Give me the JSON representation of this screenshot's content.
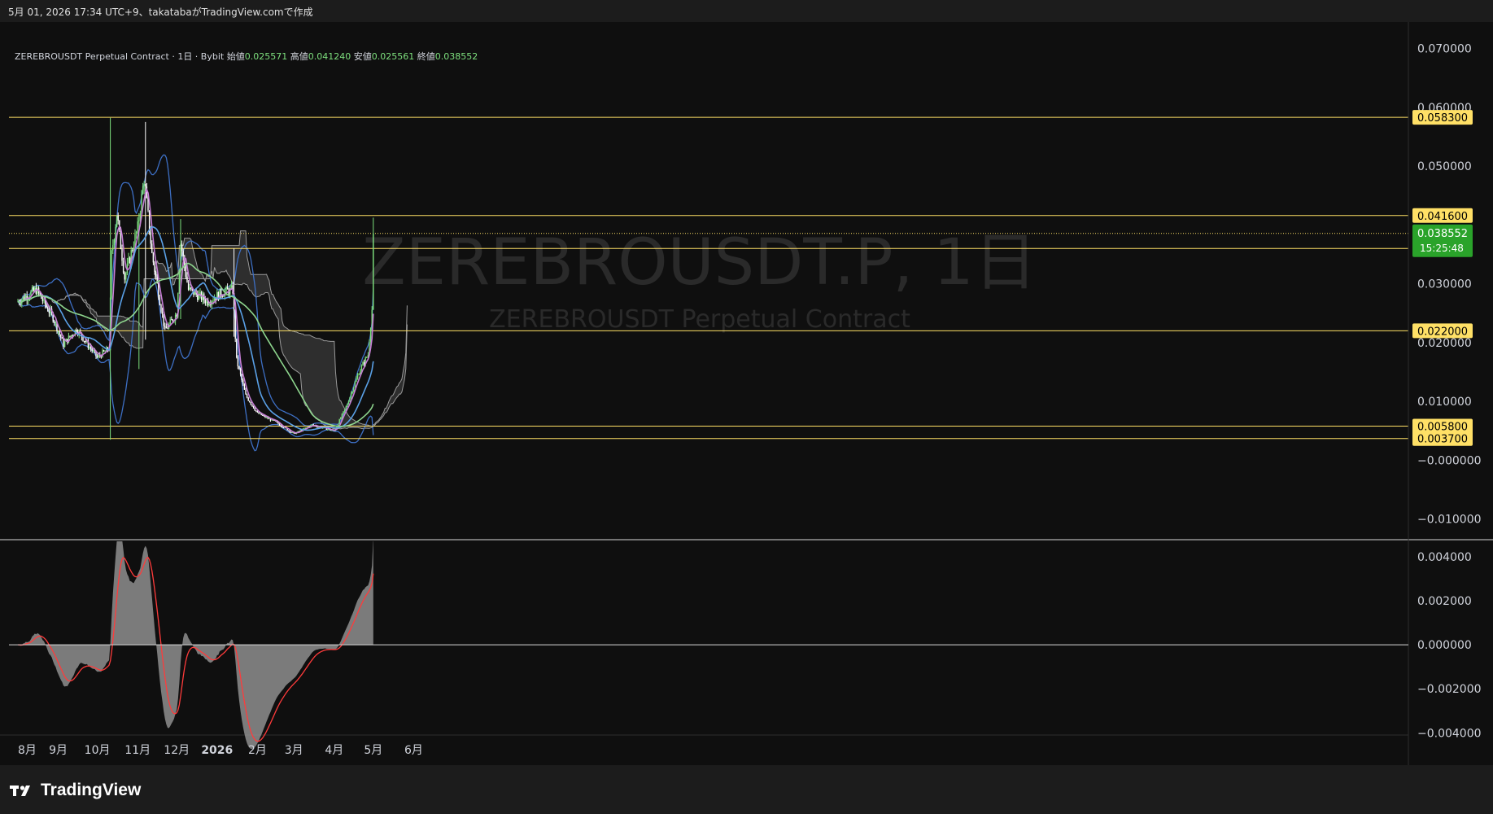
{
  "header": {
    "snapshot_text": "5月 01, 2026 17:34 UTC+9、takatabaがTradingView.comで作成"
  },
  "legend": {
    "symbol_line": "ZEREBROUSDT Perpetual Contract · 1日 · Bybit",
    "open_label": "始値",
    "open": "0.025571",
    "high_label": "高値",
    "high": "0.041240",
    "low_label": "安値",
    "low": "0.025561",
    "close_label": "終値",
    "close": "0.038552"
  },
  "watermark": {
    "title": "ZEREBROUSDT.P, 1日",
    "subtitle": "ZEREBROUSDT Perpetual Contract"
  },
  "footer": {
    "brand": "TradingView"
  },
  "colors": {
    "background": "#0f0f0f",
    "frame": "#1c1c1c",
    "up_candle": "#7ee07e",
    "down_candle": "#ffffff",
    "level_line": "#ffe066",
    "ma_fast": "#c77fd6",
    "ma_mid": "#5aa0e6",
    "ma_slow": "#8ed68e",
    "bollinger": "#3d6fc4",
    "cloud": "#6b6b6b",
    "oscillator": "#8e8e8e",
    "signal": "#ff3b3b"
  },
  "chart_data": [
    {
      "type": "candlestick",
      "title": "ZEREBROUSDT.P, 1日",
      "x_axis": {
        "labels": [
          "8月",
          "9月",
          "10月",
          "11月",
          "12月",
          "2026",
          "2月",
          "3月",
          "4月",
          "5月",
          "6月"
        ],
        "label_dates": [
          "2025-08-01",
          "2025-09-01",
          "2025-10-01",
          "2025-11-01",
          "2025-12-01",
          "2026-01-01",
          "2026-02-01",
          "2026-03-01",
          "2026-04-01",
          "2026-05-01",
          "2026-06-01"
        ]
      },
      "y_axis": {
        "ticks": [
          "0.070000",
          "0.060000",
          "0.050000",
          "0.030000",
          "0.020000",
          "0.010000",
          "−0.000000",
          "−0.010000"
        ],
        "tick_values": [
          0.07,
          0.06,
          0.05,
          0.03,
          0.02,
          0.01,
          0.0,
          -0.01
        ],
        "range": [
          -0.0135,
          0.0745
        ]
      },
      "levels": [
        {
          "label": "0.058300",
          "value": 0.0583
        },
        {
          "label": "0.041600",
          "value": 0.0416
        },
        {
          "label": "0.036000",
          "value": 0.036
        },
        {
          "label": "0.022000",
          "value": 0.022
        },
        {
          "label": "0.005800",
          "value": 0.0058
        },
        {
          "label": "0.003700",
          "value": 0.0037
        }
      ],
      "last_price": {
        "label": "0.038552",
        "value": 0.038552,
        "countdown": "15:25:48"
      },
      "anchors": [
        {
          "date": "2025-08-01",
          "close": 0.027
        },
        {
          "date": "2025-08-15",
          "close": 0.029
        },
        {
          "date": "2025-08-28",
          "close": 0.0243
        },
        {
          "date": "2025-09-05",
          "close": 0.0197
        },
        {
          "date": "2025-09-15",
          "close": 0.0223
        },
        {
          "date": "2025-10-01",
          "close": 0.0175
        },
        {
          "date": "2025-10-10",
          "close": 0.019
        },
        {
          "date": "2025-10-12",
          "close": 0.035
        },
        {
          "date": "2025-10-16",
          "close": 0.042
        },
        {
          "date": "2025-10-22",
          "close": 0.031
        },
        {
          "date": "2025-11-01",
          "close": 0.0395
        },
        {
          "date": "2025-11-06",
          "close": 0.048
        },
        {
          "date": "2025-11-12",
          "close": 0.035
        },
        {
          "date": "2025-11-22",
          "close": 0.022
        },
        {
          "date": "2025-12-01",
          "close": 0.025
        },
        {
          "date": "2025-12-04",
          "close": 0.037
        },
        {
          "date": "2025-12-10",
          "close": 0.029
        },
        {
          "date": "2025-12-25",
          "close": 0.027
        },
        {
          "date": "2026-01-05",
          "close": 0.0285
        },
        {
          "date": "2026-01-13",
          "close": 0.029
        },
        {
          "date": "2026-01-16",
          "close": 0.017
        },
        {
          "date": "2026-01-23",
          "close": 0.011
        },
        {
          "date": "2026-02-01",
          "close": 0.008
        },
        {
          "date": "2026-02-15",
          "close": 0.0065
        },
        {
          "date": "2026-03-01",
          "close": 0.0045
        },
        {
          "date": "2026-03-15",
          "close": 0.006
        },
        {
          "date": "2026-04-01",
          "close": 0.005
        },
        {
          "date": "2026-04-10",
          "close": 0.009
        },
        {
          "date": "2026-04-20",
          "close": 0.015
        },
        {
          "date": "2026-04-27",
          "close": 0.018
        },
        {
          "date": "2026-04-30",
          "close": 0.0256
        },
        {
          "date": "2026-05-01",
          "close": 0.0386
        }
      ],
      "last_candle": {
        "date": "2026-05-01",
        "open": 0.025571,
        "high": 0.04124,
        "low": 0.025561,
        "close": 0.038552
      },
      "indicators": [
        "moving averages",
        "Bollinger bands",
        "Ichimoku cloud"
      ]
    },
    {
      "type": "area",
      "y_axis": {
        "ticks": [
          "0.004000",
          "0.002000",
          "0.000000",
          "−0.002000",
          "−0.004000"
        ],
        "tick_values": [
          0.004,
          0.002,
          0.0,
          -0.002,
          -0.004
        ],
        "range": [
          -0.0041,
          0.0047
        ]
      },
      "series": [
        {
          "kind": "histogram",
          "color": "#8e8e8e"
        },
        {
          "kind": "signal",
          "color": "#ff3b3b"
        }
      ]
    }
  ]
}
